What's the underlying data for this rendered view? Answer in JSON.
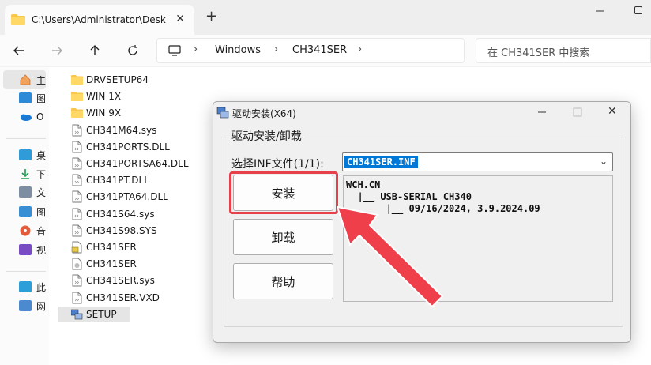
{
  "explorer": {
    "tab_title": "C:\\Users\\Administrator\\Deskto",
    "tab_close": "✕",
    "new_tab": "+",
    "breadcrumb": [
      "Windows",
      "CH341SER"
    ],
    "search_placeholder": "在 CH341SER 中搜索",
    "sidebar": [
      {
        "label": "主",
        "icon": "home-icon"
      },
      {
        "label": "图",
        "icon": "gallery-icon"
      },
      {
        "label": "O",
        "icon": "onedrive-icon"
      },
      {
        "label": "桌",
        "icon": "desktop-icon"
      },
      {
        "label": "下",
        "icon": "download-icon"
      },
      {
        "label": "文",
        "icon": "documents-icon"
      },
      {
        "label": "图",
        "icon": "pictures-icon"
      },
      {
        "label": "音",
        "icon": "music-icon"
      },
      {
        "label": "视",
        "icon": "videos-icon"
      },
      {
        "label": "此",
        "icon": "this-pc-icon"
      },
      {
        "label": "网",
        "icon": "network-icon"
      }
    ],
    "files": [
      {
        "name": "DRVSETUP64",
        "type": "folder"
      },
      {
        "name": "WIN 1X",
        "type": "folder"
      },
      {
        "name": "WIN 9X",
        "type": "folder"
      },
      {
        "name": "CH341M64.sys",
        "type": "file"
      },
      {
        "name": "CH341PORTS.DLL",
        "type": "file"
      },
      {
        "name": "CH341PORTSA64.DLL",
        "type": "file"
      },
      {
        "name": "CH341PT.DLL",
        "type": "file"
      },
      {
        "name": "CH341PTA64.DLL",
        "type": "file"
      },
      {
        "name": "CH341S64.sys",
        "type": "file"
      },
      {
        "name": "CH341S98.SYS",
        "type": "file"
      },
      {
        "name": "CH341SER",
        "type": "inf"
      },
      {
        "name": "CH341SER",
        "type": "cat"
      },
      {
        "name": "CH341SER.sys",
        "type": "file"
      },
      {
        "name": "CH341SER.VXD",
        "type": "file"
      },
      {
        "name": "SETUP",
        "type": "exe"
      }
    ],
    "selected_file": "SETUP"
  },
  "dialog": {
    "title": "驱动安装(X64)",
    "group_label": "驱动安装/卸载",
    "inf_label": "选择INF文件(1/1):",
    "inf_value": "CH341SER.INF",
    "buttons": {
      "install": "安装",
      "uninstall": "卸载",
      "help": "帮助"
    },
    "info": [
      "WCH.CN",
      "  |__ USB-SERIAL CH340",
      "       |__ 09/16/2024, 3.9.2024.09"
    ],
    "close": "✕"
  },
  "colors": {
    "highlight": "#e8404a",
    "selection": "#0078d7"
  }
}
